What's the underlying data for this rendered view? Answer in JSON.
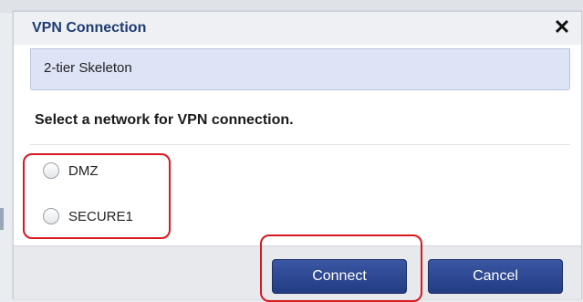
{
  "dialog": {
    "title": "VPN Connection",
    "close_glyph": "✕",
    "subtitle": "2-tier Skeleton",
    "prompt": "Select a network for VPN connection.",
    "options": [
      {
        "label": "DMZ",
        "selected": false
      },
      {
        "label": "SECURE1",
        "selected": false
      }
    ],
    "buttons": {
      "connect_label": "Connect",
      "cancel_label": "Cancel"
    }
  },
  "colors": {
    "title_text": "#1f3b73",
    "button": "#2d4a96",
    "highlight": "#d9181f",
    "subheader_bg": "#dde4f6"
  },
  "icons": {
    "close": "close-icon"
  }
}
